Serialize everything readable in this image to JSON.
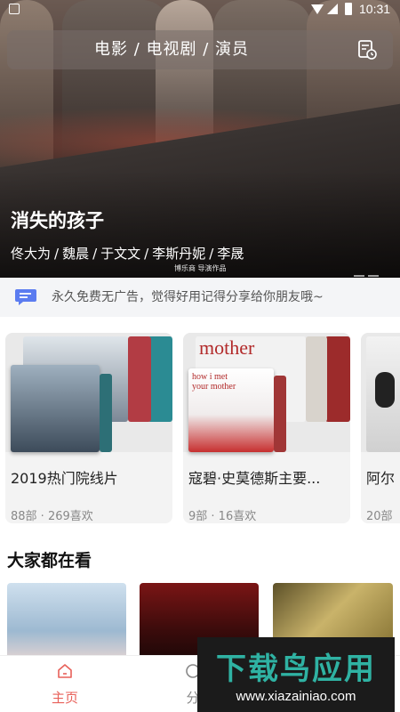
{
  "status_bar": {
    "time": "10:31"
  },
  "header": {
    "tabs_text": "电影 / 电视剧 / 演员"
  },
  "hero": {
    "title": "消失的孩子",
    "cast": [
      "佟大为",
      "魏晨",
      "于文文",
      "李斯丹妮",
      "李晟"
    ],
    "separator": "/",
    "credit": "博乐商 导演作品"
  },
  "notice": {
    "text": "永久免费无广告，觉得好用记得分享给你朋友哦~"
  },
  "collections": [
    {
      "title": "2019热门院线片",
      "meta": "88部 · 269喜欢"
    },
    {
      "title": "寇碧·史莫德斯主要...",
      "meta": "9部 · 16喜欢"
    },
    {
      "title": "阿尔",
      "meta": "20部"
    }
  ],
  "section": {
    "title": "大家都在看"
  },
  "tabbar": {
    "items": [
      {
        "label": "主页",
        "icon": "home-icon"
      },
      {
        "label": "分",
        "icon": "category-icon"
      }
    ]
  },
  "poster_text": {
    "mother_top": "mother",
    "mother_card": "how i met your mother"
  },
  "watermark": {
    "main": "下载鸟应用",
    "sub": "www.xiazainiao.com"
  },
  "colors": {
    "accent": "#e8615a",
    "notice_icon": "#5b7cf0",
    "watermark_text": "#2fb2a3"
  }
}
